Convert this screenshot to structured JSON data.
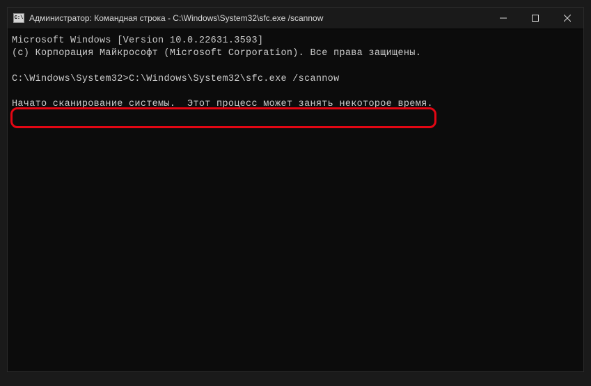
{
  "titlebar": {
    "icon_label": "C:\\",
    "title": "Администратор: Командная строка - C:\\Windows\\System32\\sfc.exe  /scannow"
  },
  "terminal": {
    "line1": "Microsoft Windows [Version 10.0.22631.3593]",
    "line2": "(c) Корпорация Майкрософт (Microsoft Corporation). Все права защищены.",
    "prompt": "C:\\Windows\\System32>",
    "command": "C:\\Windows\\System32\\sfc.exe /scannow",
    "output": "Начато сканирование системы.  Этот процесс может занять некоторое время."
  }
}
